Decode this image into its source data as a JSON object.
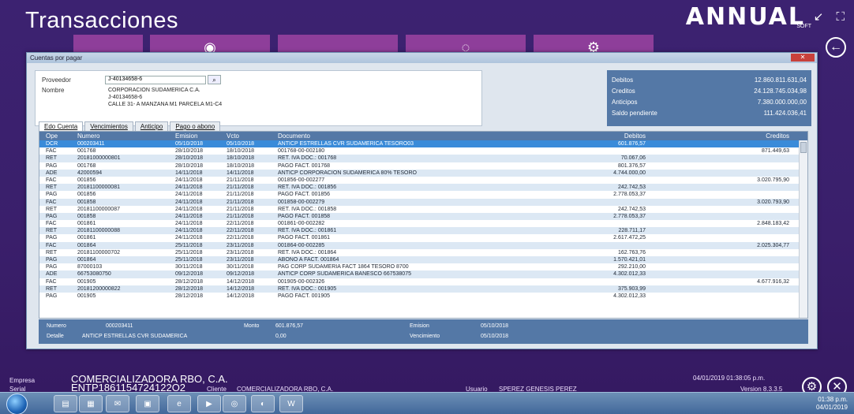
{
  "app": {
    "title": "Transacciones",
    "logo": "ANNUAL",
    "logo_sub": "SOFT",
    "window_controls": "↙ ⛶"
  },
  "dialog": {
    "title": "Cuentas por pagar",
    "close_label": "✕",
    "proveedor_label": "Proveedor",
    "proveedor_value": "J-40134658-6",
    "nombre_label": "Nombre",
    "nombre_lines": [
      "CORPORACION SUDAMERICA C.A.",
      "J-40134658-6",
      "CALLE 31- A MANZANA M1 PARCELA M1-C4"
    ],
    "search_icon": "search-icon"
  },
  "totals": [
    {
      "label": "Debitos",
      "value": "12.860.811.631,04"
    },
    {
      "label": "Creditos",
      "value": "24.128.745.034,98"
    },
    {
      "label": "Anticipos",
      "value": "7.380.000.000,00"
    },
    {
      "label": "Saldo pendiente",
      "value": "111.424.036,41"
    }
  ],
  "tabs": [
    "Edo Cuenta",
    "Vencimientos",
    "Anticipo",
    "Pago o abono"
  ],
  "grid": {
    "headers": [
      "Ope",
      "Numero",
      "Emision",
      "Vcto",
      "Documento",
      "Debitos",
      "Creditos"
    ],
    "rows": [
      [
        "DCR",
        "000203411",
        "05/10/2018",
        "05/10/2018",
        "ANTICP ESTRELLAS CVR SUDAMERICA TESORO03",
        "601.876,57",
        ""
      ],
      [
        "FAC",
        "001768",
        "28/10/2018",
        "18/10/2018",
        "001768-00-002180",
        "",
        "871.449,63"
      ],
      [
        "RET",
        "20181000000801",
        "28/10/2018",
        "18/10/2018",
        "RET. IVA DOC.: 001768",
        "70.067,06",
        ""
      ],
      [
        "PAG",
        "001768",
        "28/10/2018",
        "18/10/2018",
        "PAGO FACT. 001768",
        "801.376,57",
        ""
      ],
      [
        "ADE",
        "42000594",
        "14/11/2018",
        "14/11/2018",
        "ANTICP CORPORACION SUDAMERICA 80% TESORO",
        "4.744.000,00",
        ""
      ],
      [
        "FAC",
        "001856",
        "24/11/2018",
        "21/11/2018",
        "001856-00-002277",
        "",
        "3.020.795,90"
      ],
      [
        "RET",
        "20181100000081",
        "24/11/2018",
        "21/11/2018",
        "RET. IVA DOC.: 001856",
        "242.742,53",
        ""
      ],
      [
        "PAG",
        "001856",
        "24/11/2018",
        "21/11/2018",
        "PAGO FACT. 001856",
        "2.778.053,37",
        ""
      ],
      [
        "FAC",
        "001858",
        "24/11/2018",
        "21/11/2018",
        "001858-00-002279",
        "",
        "3.020.793,90"
      ],
      [
        "RET",
        "20181100000087",
        "24/11/2018",
        "21/11/2018",
        "RET. IVA DOC.: 001858",
        "242.742,53",
        ""
      ],
      [
        "PAG",
        "001858",
        "24/11/2018",
        "21/11/2018",
        "PAGO FACT. 001858",
        "2.778.053,37",
        ""
      ],
      [
        "FAC",
        "001861",
        "24/11/2018",
        "22/11/2018",
        "001861-00-002282",
        "",
        "2.848.183,42"
      ],
      [
        "RET",
        "20181100000088",
        "24/11/2018",
        "22/11/2018",
        "RET. IVA DOC.: 001861",
        "228.711,17",
        ""
      ],
      [
        "PAG",
        "001861",
        "24/11/2018",
        "22/11/2018",
        "PAGO FACT. 001861",
        "2.617.472,25",
        ""
      ],
      [
        "FAC",
        "001864",
        "25/11/2018",
        "23/11/2018",
        "001864-00-002285",
        "",
        "2.025.304,77"
      ],
      [
        "RET",
        "20181100000702",
        "25/11/2018",
        "23/11/2018",
        "RET. IVA DOC.: 001864",
        "162.763,76",
        ""
      ],
      [
        "PAG",
        "001864",
        "25/11/2018",
        "23/11/2018",
        "ABONO A FACT. 001864",
        "1.570.421,01",
        ""
      ],
      [
        "PAG",
        "87000103",
        "30/11/2018",
        "30/11/2018",
        "PAG CORP SUDAMERIA FACT 1864 TESORO 8700",
        "292.210,00",
        ""
      ],
      [
        "ADE",
        "66753080750",
        "09/12/2018",
        "09/12/2018",
        "ANTICP CORP SUDAMERICA BANESCO 667538075",
        "4.302.012,33",
        ""
      ],
      [
        "FAC",
        "001905",
        "28/12/2018",
        "14/12/2018",
        "001905-00-002326",
        "",
        "4.677.916,32"
      ],
      [
        "RET",
        "20181200000822",
        "28/12/2018",
        "14/12/2018",
        "RET. IVA DOC.: 001905",
        "375.903,99",
        ""
      ],
      [
        "PAG",
        "001905",
        "28/12/2018",
        "14/12/2018",
        "PAGO FACT. 001905",
        "4.302.012,33",
        ""
      ]
    ]
  },
  "detail": {
    "numero_label": "Numero",
    "numero_value": "000203411",
    "monto_label": "Monto",
    "monto_value": "601.876,57",
    "emision_label": "Emision",
    "emision_value": "05/10/2018",
    "detalle_label": "Detalle",
    "detalle_value": "ANTICP ESTRELLAS CVR SUDAMERICA",
    "iva_value": "0,00",
    "vencimiento_label": "Vencimiento",
    "vencimiento_value": "05/10/2018"
  },
  "status": {
    "empresa_label": "Empresa",
    "empresa_value": "COMERCIALIZADORA RBO, C.A.",
    "serial_label": "Serial",
    "serial_value": "ENTP1861154724122O2",
    "cliente_label": "Cliente",
    "cliente_value": "COMERCIALIZADORA RBO, C.A.",
    "usuario_label": "Usuario",
    "usuario_value": "SPEREZ GENESIS PEREZ",
    "datetime": "04/01/2019 01:38:05 p.m.",
    "version": "Version 8.3.3.5"
  },
  "taskbar": {
    "tray_time": "01:38 p.m.",
    "tray_date": "04/01/2019",
    "icons": [
      "explorer-icon",
      "desktop-icon",
      "outlook-icon",
      "monitor-icon",
      "ie-icon",
      "media-icon",
      "chrome-icon",
      "annual-icon",
      "word-icon"
    ]
  }
}
